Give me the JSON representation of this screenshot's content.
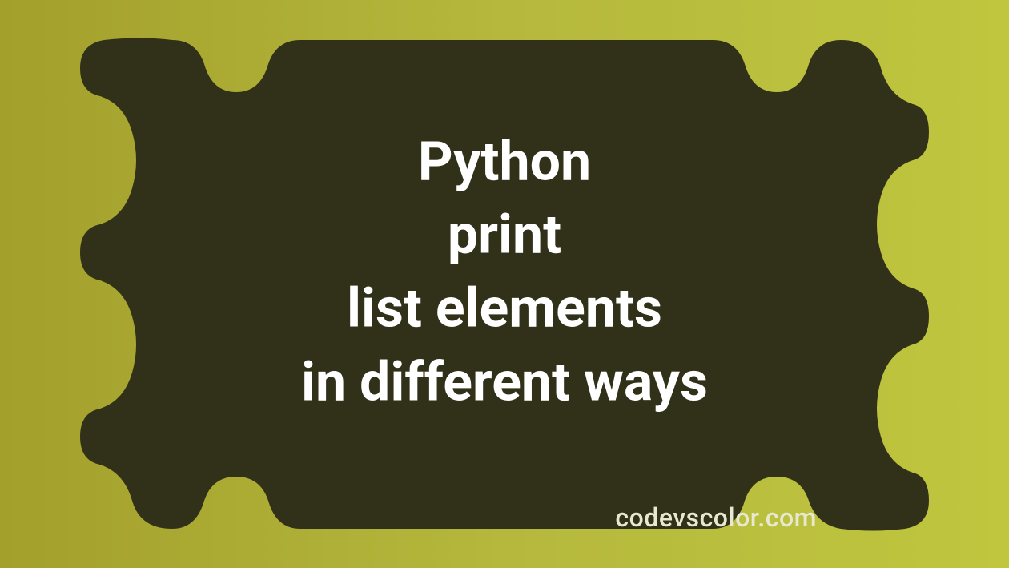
{
  "title": {
    "line1": "Python",
    "line2": "print",
    "line3": "list elements",
    "line4": "in different ways"
  },
  "watermark": "codevscolor.com",
  "colors": {
    "bg_left": "#a3a02c",
    "bg_right": "#c0c63e",
    "blob": "#31311a",
    "text": "#ffffff",
    "watermark": "#e8e8d0"
  }
}
